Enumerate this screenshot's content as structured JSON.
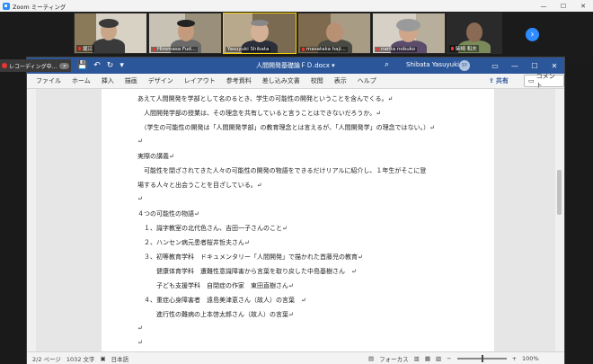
{
  "zoom": {
    "window_title": "Zoom ミーティング",
    "controls": [
      "—",
      "☐",
      "✕"
    ],
    "participants": [
      {
        "name": "堀江"
      },
      {
        "name": "Hiromasa Fud..."
      },
      {
        "name": "Yasuyuki Shibata"
      },
      {
        "name": "masataka haji..."
      },
      {
        "name": "narita nobuko"
      },
      {
        "name": "柴崎 和夫"
      }
    ],
    "next_label": "›",
    "recording": {
      "label": "レコーディング中...",
      "badge": "ァ"
    }
  },
  "word": {
    "doc_title": "人間開発基礎論ＦＤ.docx ▾",
    "quick_access": [
      "💾",
      "↶",
      "↻",
      "▾"
    ],
    "user_name": "Shibata Yasuyuki",
    "avatar_initials": "SY",
    "window_controls": [
      "▭",
      "—",
      "☐",
      "✕"
    ],
    "menu": [
      "ファイル",
      "ホーム",
      "挿入",
      "描画",
      "デザイン",
      "レイアウト",
      "参考資料",
      "差し込み文書",
      "校閲",
      "表示",
      "ヘルプ"
    ],
    "share_label": "共有",
    "comment_label": "コメント",
    "doc_lines": [
      "あえて人間開発を学部として名のるとき、学生の可能性の開発ということを含んでくる。↵",
      "　人間開発学部の授業は、その理念を共有していると言うことはできないだろうか。↵",
      "　（学生の可能性の開発は「人間開発学部」の教育理念とは言えるが、「人間開発学」の理念ではない。）↵",
      "↵",
      "実際の講義↵",
      "　可能性を閉ざされてきた人々の可能性の開発の物語をできるだけリアルに紹介し、１年生がそこに登",
      "場する人々と出会うことを目ざしている。↵",
      "↵",
      "４つの可能性の物語↵",
      "　１、識字教室の北代色さん、吉田一子さんのこと↵",
      "　２、ハンセン病元患者桜井哲夫さん↵",
      "　３、初等教育学科　ドキュメンタリー「人間開発」で描かれた首藤児の教育↵",
      "　　　健康体育学科　遭難性意識障害から言葉を取り戻した中島基樹さん　↵",
      "　　　子ども支援学科　自閉症の作家　東田直樹さん↵",
      "　４、重症心身障害者　遠島美津恵さん（故人）の言葉　↵",
      "　　　進行性の難病の上本啓太郎さん（故人）の言葉↵",
      "↵",
      "↵"
    ],
    "status": {
      "page": "2/2 ページ",
      "words": "1032 文字",
      "lang": "日本語",
      "focus": "フォーカス",
      "zoom": "100%"
    }
  }
}
